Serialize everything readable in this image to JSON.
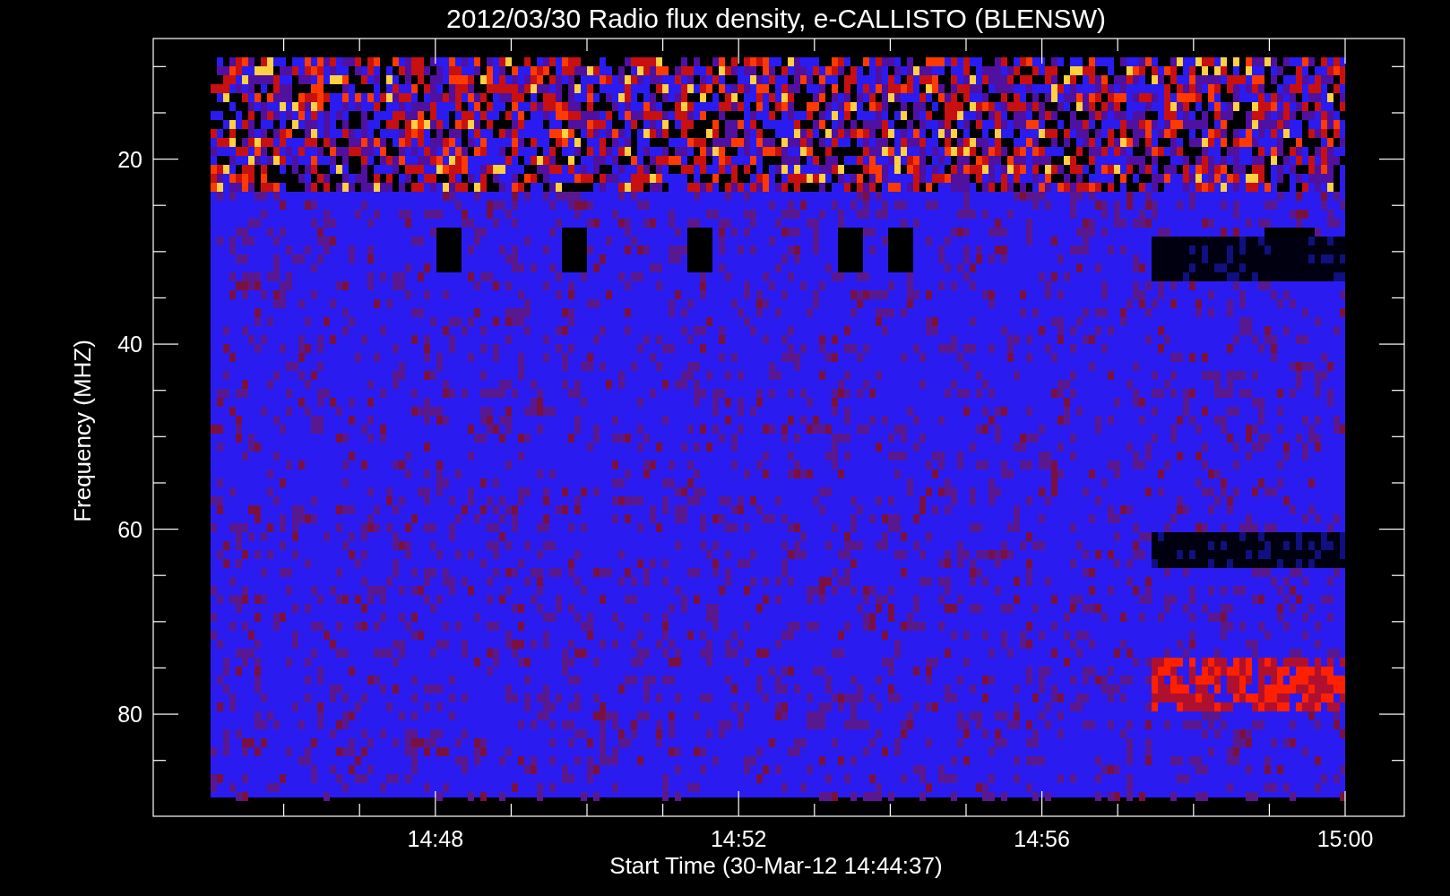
{
  "plot": {
    "title": "2012/03/30  Radio flux density, e-CALLISTO (BLENSW)",
    "ylabel": "Frequency (MHZ)",
    "xlabel": "Start Time (30-Mar-12 14:44:37)",
    "yticks": [
      "20",
      "40",
      "60",
      "80"
    ],
    "xticks": [
      "14:48",
      "14:52",
      "14:56",
      "15:00"
    ]
  }
}
